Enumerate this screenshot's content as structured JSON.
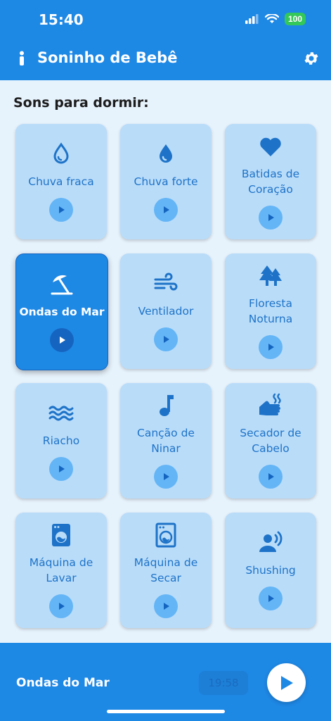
{
  "status_bar": {
    "time": "15:40",
    "battery": "100"
  },
  "app": {
    "title": "Soninho de Bebê"
  },
  "section": {
    "title": "Sons para dormir:"
  },
  "sounds": [
    {
      "label": "Chuva fraca",
      "icon": "droplet-outline-icon"
    },
    {
      "label": "Chuva forte",
      "icon": "droplet-filled-icon"
    },
    {
      "label": "Batidas de Coração",
      "icon": "heart-icon"
    },
    {
      "label": "Ondas do Mar",
      "icon": "umbrella-beach-icon",
      "active": true
    },
    {
      "label": "Ventilador",
      "icon": "wind-icon"
    },
    {
      "label": "Floresta Noturna",
      "icon": "trees-icon"
    },
    {
      "label": "Riacho",
      "icon": "water-waves-icon"
    },
    {
      "label": "Canção de Ninar",
      "icon": "music-note-icon"
    },
    {
      "label": "Secador de Cabelo",
      "icon": "hand-heat-icon"
    },
    {
      "label": "Máquina de Lavar",
      "icon": "washing-machine-icon"
    },
    {
      "label": "Máquina de Secar",
      "icon": "dryer-icon"
    },
    {
      "label": "Shushing",
      "icon": "voice-icon"
    }
  ],
  "player": {
    "now_playing": "Ondas do Mar",
    "timer": "19:58"
  },
  "colors": {
    "primary": "#1e88e5",
    "card": "#b9dcf9",
    "accent_text": "#1e73c8"
  }
}
